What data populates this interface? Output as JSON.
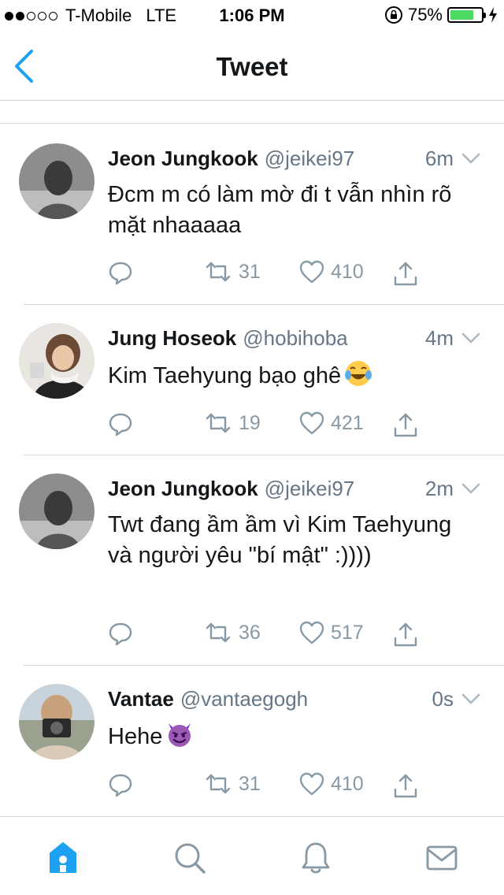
{
  "status_bar": {
    "carrier": "T-Mobile",
    "network": "LTE",
    "time": "1:06 PM",
    "battery": "75%",
    "battery_level": 0.75,
    "signal_bars": 2
  },
  "nav": {
    "title": "Tweet",
    "back_icon": "chevron-left-icon"
  },
  "tweets": [
    {
      "name": "Jeon Jungkook",
      "handle": "@jeikei97",
      "time": "6m",
      "text": "Đcm m có làm mờ đi t vẫn nhìn rõ mặt nhaaaaa",
      "retweets": "31",
      "likes": "410"
    },
    {
      "name": "Jung Hoseok",
      "handle": "@hobihoba",
      "time": "4m",
      "text": "Kim Taehyung bạo ghê",
      "emoji": "tears-of-joy-emoji",
      "retweets": "19",
      "likes": "421"
    },
    {
      "name": "Jeon Jungkook",
      "handle": "@jeikei97",
      "time": "2m",
      "text": "Twt đang ầm ầm vì Kim Taehyung và người yêu \"bí mật\" :))))",
      "retweets": "36",
      "likes": "517"
    },
    {
      "name": "Vantae",
      "handle": "@vantaegogh",
      "time": "0s",
      "text": "Hehe",
      "emoji": "smiling-devil-emoji",
      "retweets": "31",
      "likes": "410"
    }
  ],
  "tabbar": {
    "items": [
      "home-icon",
      "search-icon",
      "notifications-icon",
      "messages-icon"
    ],
    "active_color": "#1da1f2",
    "inactive_color": "#8899a6"
  },
  "colors": {
    "accent": "#1da1f2",
    "secondary_text": "#657786",
    "icon_gray": "#8899a6",
    "battery_green": "#4cd964"
  }
}
